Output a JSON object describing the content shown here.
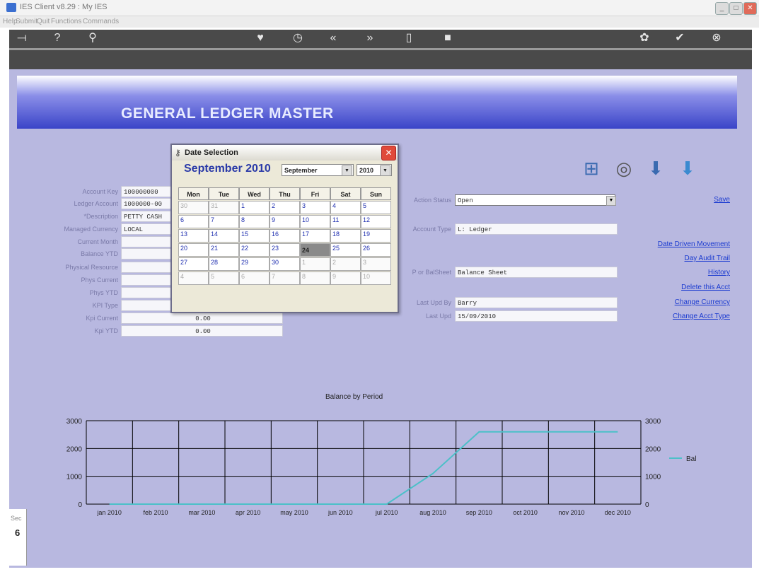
{
  "window": {
    "title": "IES Client v8.29 : My IES"
  },
  "menu": [
    "Help",
    "Submit",
    "Quit",
    "Functions",
    "Commands"
  ],
  "toolbar": [
    {
      "icon": "key-icon",
      "glyph": "⟞"
    },
    {
      "icon": "help-icon",
      "glyph": "?"
    },
    {
      "icon": "search-icon",
      "glyph": "⚲"
    },
    {
      "icon": "heart-icon",
      "glyph": "♥"
    },
    {
      "icon": "clock-icon",
      "glyph": "◷"
    },
    {
      "icon": "back-icon",
      "glyph": "«"
    },
    {
      "icon": "forward-icon",
      "glyph": "»"
    },
    {
      "icon": "document-icon",
      "glyph": "▯"
    },
    {
      "icon": "stop-icon",
      "glyph": "■"
    },
    {
      "icon": "settings-icon",
      "glyph": "✿"
    },
    {
      "icon": "confirm-icon",
      "glyph": "✔"
    },
    {
      "icon": "close-icon",
      "glyph": "⊗"
    }
  ],
  "banner": {
    "title": "GENERAL LEDGER MASTER"
  },
  "form_left": {
    "labels": [
      "Account Key",
      "Ledger Account",
      "*Description",
      "Managed Currency",
      "Current Month",
      "Balance YTD",
      "Physical Resource",
      "Phys Current",
      "Phys YTD",
      "KPI Type",
      "Kpi Current",
      "Kpi YTD"
    ],
    "values": [
      "100000000",
      "1000000-00",
      "PETTY CASH",
      "LOCAL",
      "",
      "",
      "",
      "",
      "",
      "",
      "0.00",
      "0.00"
    ]
  },
  "form_right": {
    "labels": [
      "Action Status",
      "Account Type",
      "P or BalSheet",
      "Last Upd By",
      "Last Upd"
    ],
    "values": [
      "Open",
      "L: Ledger",
      "Balance Sheet",
      "Barry",
      "15/09/2010"
    ]
  },
  "links": [
    "Save",
    "Date Driven Movement",
    "Day Audit Trail",
    "History",
    "Delete this Acct",
    "Change Currency",
    "Change Acct Type"
  ],
  "right_icons": [
    "hierarchy-icon",
    "globe-icon",
    "download-icon",
    "import-icon"
  ],
  "dialog": {
    "title": "Date Selection",
    "month_title": "September 2010",
    "month_select": "September",
    "year_select": "2010",
    "weekdays": [
      "Mon",
      "Tue",
      "Wed",
      "Thu",
      "Fri",
      "Sat",
      "Sun"
    ],
    "days": [
      [
        "30",
        "31",
        "1",
        "2",
        "3",
        "4",
        "5"
      ],
      [
        "6",
        "7",
        "8",
        "9",
        "10",
        "11",
        "12"
      ],
      [
        "13",
        "14",
        "15",
        "16",
        "17",
        "18",
        "19"
      ],
      [
        "20",
        "21",
        "22",
        "23",
        "24",
        "25",
        "26"
      ],
      [
        "27",
        "28",
        "29",
        "30",
        "1",
        "2",
        "3"
      ],
      [
        "4",
        "5",
        "6",
        "7",
        "8",
        "9",
        "10"
      ]
    ],
    "selected_day": "24"
  },
  "chart_data": {
    "type": "line",
    "title": "Balance by Period",
    "categories": [
      "jan 2010",
      "feb 2010",
      "mar 2010",
      "apr 2010",
      "may 2010",
      "jun 2010",
      "jul 2010",
      "aug 2010",
      "sep 2010",
      "oct 2010",
      "nov 2010",
      "dec 2010"
    ],
    "series": [
      {
        "name": "Bal",
        "values": [
          0,
          0,
          0,
          0,
          0,
          0,
          0,
          1100,
          2600,
          2600,
          2600,
          2600
        ]
      }
    ],
    "yticks": [
      "3000",
      "2000",
      "1000",
      "0"
    ],
    "ylim": [
      0,
      3000
    ],
    "grid": true,
    "legend": "right",
    "line_color": "#4cc0c8"
  },
  "status": {
    "seg_label": "Sec",
    "glyph": "6"
  }
}
